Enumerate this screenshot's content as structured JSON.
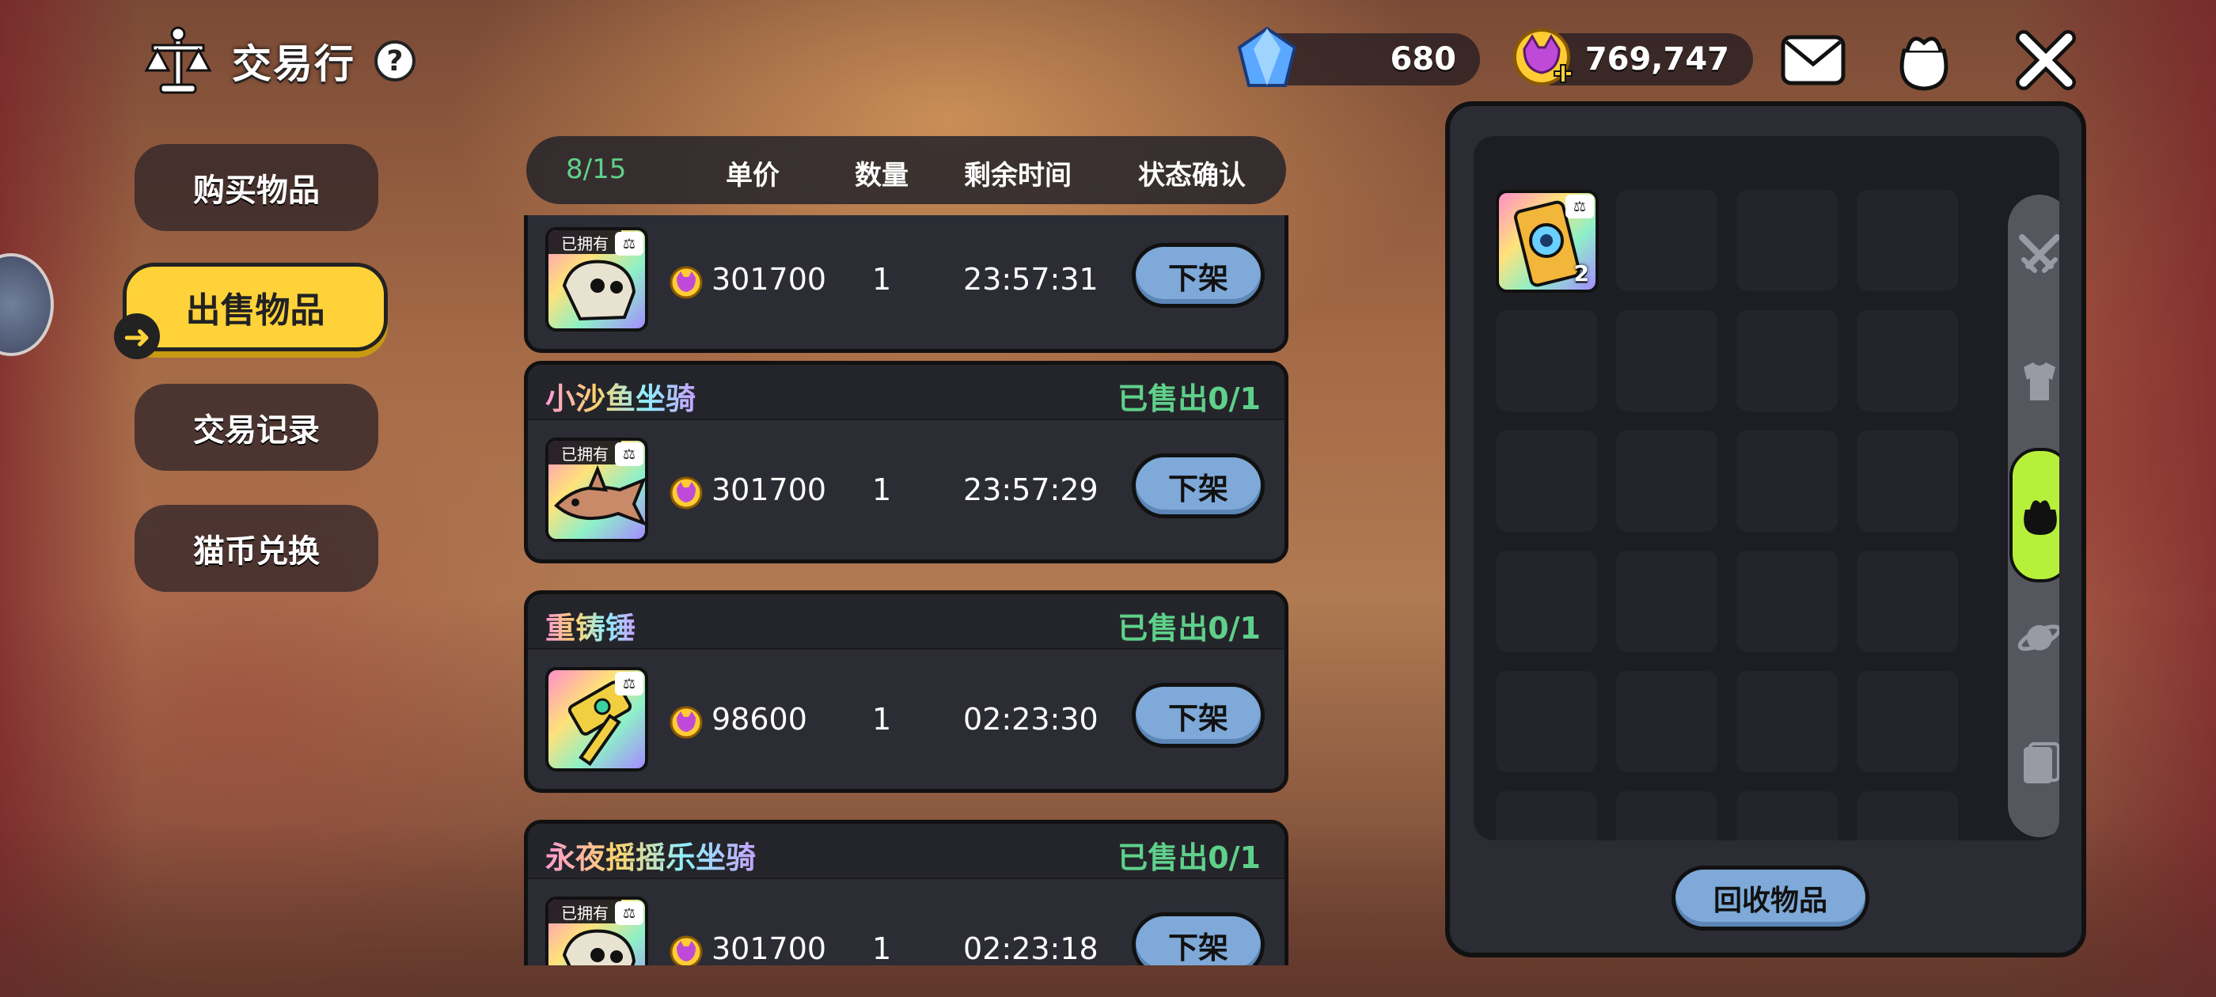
{
  "title": "交易行",
  "currency": {
    "gems": "680",
    "cat_coins": "769,747"
  },
  "tabs": [
    "购买物品",
    "出售物品",
    "交易记录",
    "猫币兑换"
  ],
  "active_tab": "出售物品",
  "list_header": {
    "count": "8/15",
    "price": "单价",
    "quantity": "数量",
    "time_left": "剩余时间",
    "status": "状态确认"
  },
  "listings": [
    {
      "name": "",
      "sold": "",
      "owned_tag": "已拥有",
      "price": "301700",
      "quantity": "1",
      "time_left": "23:57:31",
      "action": "下架"
    },
    {
      "name": "小沙鱼坐骑",
      "sold": "已售出0/1",
      "owned_tag": "已拥有",
      "price": "301700",
      "quantity": "1",
      "time_left": "23:57:29",
      "action": "下架"
    },
    {
      "name": "重铸锤",
      "sold": "已售出0/1",
      "owned_tag": "",
      "price": "98600",
      "quantity": "1",
      "time_left": "02:23:30",
      "action": "下架"
    },
    {
      "name": "永夜摇摇乐坐骑",
      "sold": "已售出0/1",
      "owned_tag": "已拥有",
      "price": "301700",
      "quantity": "1",
      "time_left": "02:23:18",
      "action": "下架"
    }
  ],
  "inventory": {
    "items": [
      {
        "count": "2",
        "icon": "ticket-icon"
      }
    ],
    "recycle_label": "回收物品"
  },
  "colors": {
    "accent_yellow": "#ffd23a",
    "sold_green": "#5fd08a",
    "button_blue": "#7ea9d8",
    "category_active": "#b6f03a"
  }
}
